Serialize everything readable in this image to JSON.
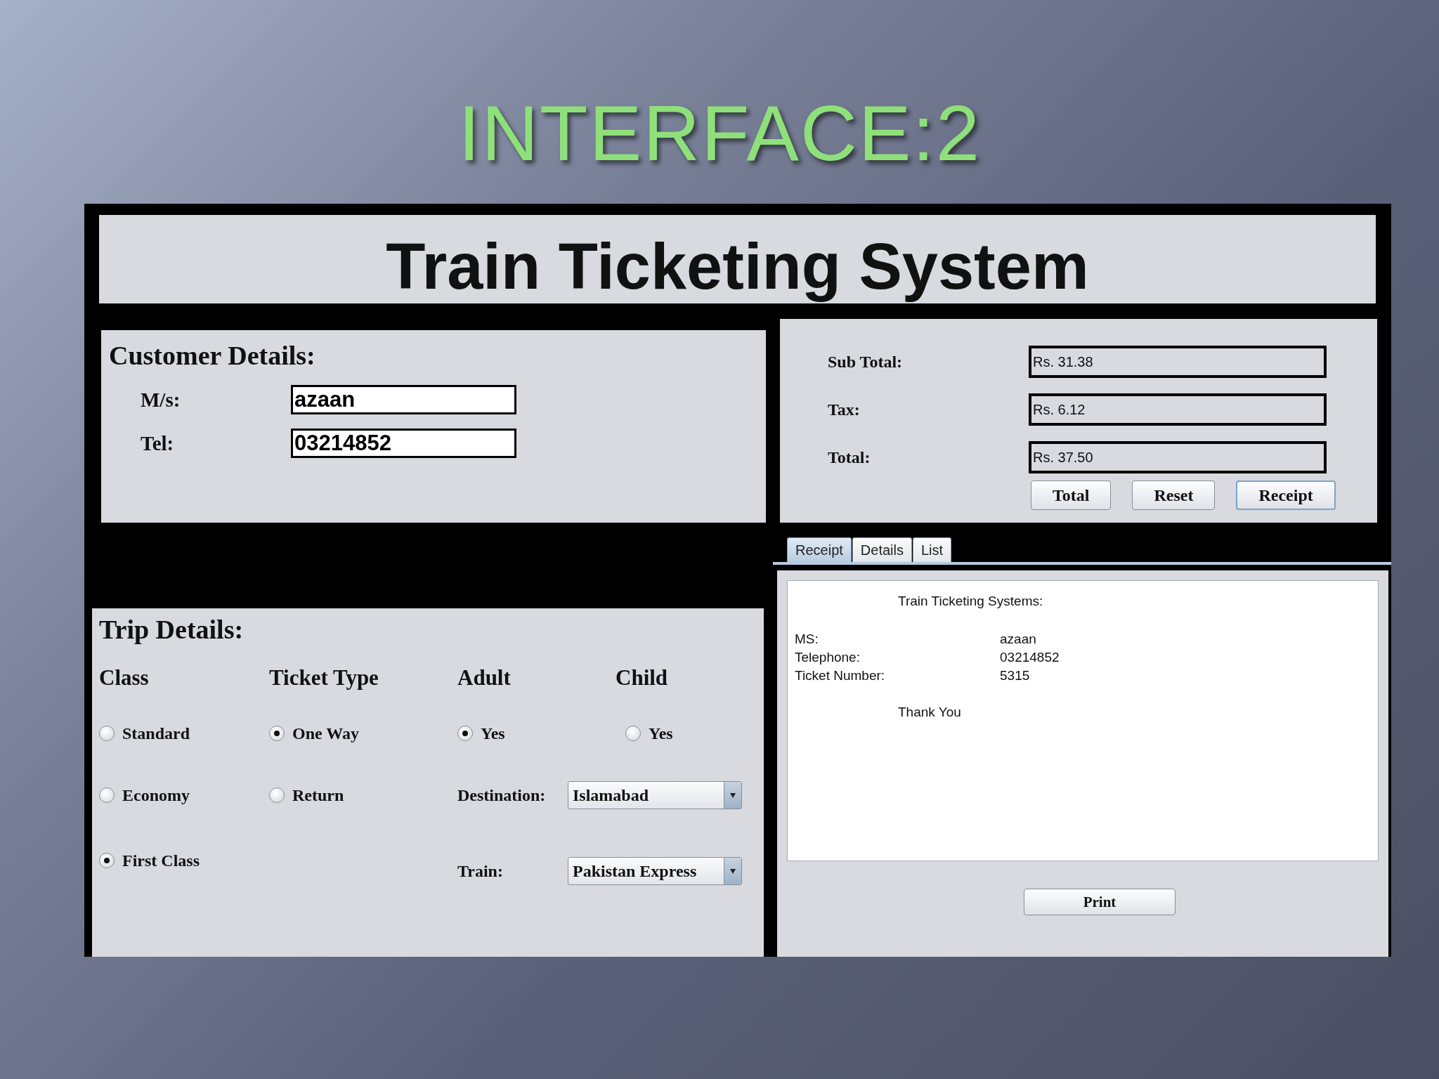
{
  "slide_title": "INTERFACE:2",
  "app": {
    "title": "Train Ticketing System",
    "customer": {
      "heading": "Customer Details:",
      "fields": [
        {
          "label": "M/s:",
          "value": "azaan"
        },
        {
          "label": "Tel:",
          "value": "03214852"
        }
      ]
    },
    "totals": {
      "fields": [
        {
          "label": "Sub Total:",
          "value": "Rs. 31.38"
        },
        {
          "label": "Tax:",
          "value": "Rs. 6.12"
        },
        {
          "label": "Total:",
          "value": "Rs. 37.50"
        }
      ],
      "buttons": [
        {
          "label": "Total",
          "focused": false
        },
        {
          "label": "Reset",
          "focused": false
        },
        {
          "label": "Receipt",
          "focused": true
        }
      ]
    },
    "tabs": [
      {
        "label": "Receipt",
        "selected": true
      },
      {
        "label": "Details",
        "selected": false
      },
      {
        "label": "List",
        "selected": false
      }
    ],
    "receipt": {
      "heading": "Train Ticketing Systems:",
      "lines": [
        {
          "label": "MS:",
          "value": "azaan"
        },
        {
          "label": "Telephone:",
          "value": "03214852"
        },
        {
          "label": "Ticket Number:",
          "value": "5315"
        }
      ],
      "closing": "Thank You"
    },
    "print_button": "Print",
    "trip": {
      "heading": "Trip Details:",
      "groups": [
        {
          "heading": "Class",
          "options": [
            {
              "label": "Standard",
              "selected": false
            },
            {
              "label": "Economy",
              "selected": false
            },
            {
              "label": "First Class",
              "selected": true
            }
          ]
        },
        {
          "heading": "Ticket Type",
          "options": [
            {
              "label": "One Way",
              "selected": true
            },
            {
              "label": "Return",
              "selected": false
            }
          ]
        },
        {
          "heading": "Adult",
          "options": [
            {
              "label": "Yes",
              "selected": true
            }
          ]
        },
        {
          "heading": "Child",
          "options": [
            {
              "label": "Yes",
              "selected": false
            }
          ]
        }
      ],
      "dropdowns": [
        {
          "label": "Destination:",
          "value": "Islamabad"
        },
        {
          "label": "Train:",
          "value": "Pakistan Express"
        }
      ]
    }
  }
}
